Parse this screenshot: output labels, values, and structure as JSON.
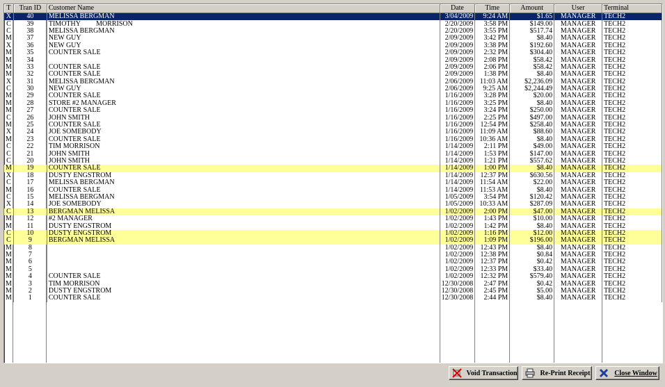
{
  "columns": {
    "type": "T",
    "tran_id": "Tran ID",
    "customer": "Customer Name",
    "date": "Date",
    "time": "Time",
    "amount": "Amount",
    "user": "User",
    "terminal": "Terminal"
  },
  "rows": [
    {
      "type": "X",
      "id": "40",
      "customer": "MELISSA BERGMAN",
      "date": "3/04/2009",
      "time": "9:24 AM",
      "amount": "$1.65",
      "user": "MANAGER",
      "terminal": "TECH2",
      "state": "selected"
    },
    {
      "type": "C",
      "id": "39",
      "customer": "TIMOTHY         MORRISON",
      "date": "2/20/2009",
      "time": "3:58 PM",
      "amount": "$149.00",
      "user": "MANAGER",
      "terminal": "TECH2",
      "state": ""
    },
    {
      "type": "C",
      "id": "38",
      "customer": "MELISSA BERGMAN",
      "date": "2/20/2009",
      "time": "3:55 PM",
      "amount": "$517.74",
      "user": "MANAGER",
      "terminal": "TECH2",
      "state": ""
    },
    {
      "type": "M",
      "id": "37",
      "customer": "NEW GUY",
      "date": "2/09/2009",
      "time": "3:42 PM",
      "amount": "$8.40",
      "user": "MANAGER",
      "terminal": "TECH2",
      "state": ""
    },
    {
      "type": "X",
      "id": "36",
      "customer": "NEW GUY",
      "date": "2/09/2009",
      "time": "3:38 PM",
      "amount": "$192.60",
      "user": "MANAGER",
      "terminal": "TECH2",
      "state": ""
    },
    {
      "type": "M",
      "id": "35",
      "customer": "COUNTER SALE",
      "date": "2/09/2009",
      "time": "2:32 PM",
      "amount": "$304.40",
      "user": "MANAGER",
      "terminal": "TECH2",
      "state": ""
    },
    {
      "type": "M",
      "id": "34",
      "customer": "",
      "date": "2/09/2009",
      "time": "2:08 PM",
      "amount": "$58.42",
      "user": "MANAGER",
      "terminal": "TECH2",
      "state": ""
    },
    {
      "type": "M",
      "id": "33",
      "customer": "COUNTER SALE",
      "date": "2/09/2009",
      "time": "2:06 PM",
      "amount": "$58.42",
      "user": "MANAGER",
      "terminal": "TECH2",
      "state": ""
    },
    {
      "type": "M",
      "id": "32",
      "customer": "COUNTER SALE",
      "date": "2/09/2009",
      "time": "1:38 PM",
      "amount": "$8.40",
      "user": "MANAGER",
      "terminal": "TECH2",
      "state": ""
    },
    {
      "type": "X",
      "id": "31",
      "customer": "MELISSA BERGMAN",
      "date": "2/06/2009",
      "time": "11:03 AM",
      "amount": "$2,236.09",
      "user": "MANAGER",
      "terminal": "TECH2",
      "state": ""
    },
    {
      "type": "C",
      "id": "30",
      "customer": "NEW GUY",
      "date": "2/06/2009",
      "time": "9:25 AM",
      "amount": "$2,244.49",
      "user": "MANAGER",
      "terminal": "TECH2",
      "state": ""
    },
    {
      "type": "M",
      "id": "29",
      "customer": "COUNTER SALE",
      "date": "1/16/2009",
      "time": "3:28 PM",
      "amount": "$20.00",
      "user": "MANAGER",
      "terminal": "TECH2",
      "state": ""
    },
    {
      "type": "M",
      "id": "28",
      "customer": "STORE #2 MANAGER",
      "date": "1/16/2009",
      "time": "3:25 PM",
      "amount": "$8.40",
      "user": "MANAGER",
      "terminal": "TECH2",
      "state": ""
    },
    {
      "type": "M",
      "id": "27",
      "customer": "COUNTER SALE",
      "date": "1/16/2009",
      "time": "3:24 PM",
      "amount": "$250.00",
      "user": "MANAGER",
      "terminal": "TECH2",
      "state": ""
    },
    {
      "type": "C",
      "id": "26",
      "customer": "JOHN SMITH",
      "date": "1/16/2009",
      "time": "2:25 PM",
      "amount": "$497.00",
      "user": "MANAGER",
      "terminal": "TECH2",
      "state": ""
    },
    {
      "type": "M",
      "id": "25",
      "customer": "COUNTER SALE",
      "date": "1/16/2009",
      "time": "12:54 PM",
      "amount": "$258.40",
      "user": "MANAGER",
      "terminal": "TECH2",
      "state": ""
    },
    {
      "type": "X",
      "id": "24",
      "customer": "JOE SOMEBODY",
      "date": "1/16/2009",
      "time": "11:09 AM",
      "amount": "$88.60",
      "user": "MANAGER",
      "terminal": "TECH2",
      "state": ""
    },
    {
      "type": "M",
      "id": "23",
      "customer": "COUNTER SALE",
      "date": "1/16/2009",
      "time": "10:36 AM",
      "amount": "$8.40",
      "user": "MANAGER",
      "terminal": "TECH2",
      "state": ""
    },
    {
      "type": "C",
      "id": "22",
      "customer": "TIM MORRISON",
      "date": "1/14/2009",
      "time": "2:11 PM",
      "amount": "$49.00",
      "user": "MANAGER",
      "terminal": "TECH2",
      "state": ""
    },
    {
      "type": "C",
      "id": "21",
      "customer": "JOHN SMITH",
      "date": "1/14/2009",
      "time": "1:53 PM",
      "amount": "$147.00",
      "user": "MANAGER",
      "terminal": "TECH2",
      "state": ""
    },
    {
      "type": "C",
      "id": "20",
      "customer": "JOHN SMITH",
      "date": "1/14/2009",
      "time": "1:21 PM",
      "amount": "$557.62",
      "user": "MANAGER",
      "terminal": "TECH2",
      "state": ""
    },
    {
      "type": "M",
      "id": "19",
      "customer": "COUNTER SALE",
      "date": "1/14/2009",
      "time": "1:00 PM",
      "amount": "$8.40",
      "user": "MANAGER",
      "terminal": "TECH2",
      "state": "highlight"
    },
    {
      "type": "X",
      "id": "18",
      "customer": "DUSTY ENGSTROM",
      "date": "1/14/2009",
      "time": "12:37 PM",
      "amount": "$630.56",
      "user": "MANAGER",
      "terminal": "TECH2",
      "state": ""
    },
    {
      "type": "C",
      "id": "17",
      "customer": "MELISSA BERGMAN",
      "date": "1/14/2009",
      "time": "11:54 AM",
      "amount": "$22.00",
      "user": "MANAGER",
      "terminal": "TECH2",
      "state": ""
    },
    {
      "type": "M",
      "id": "16",
      "customer": "COUNTER SALE",
      "date": "1/14/2009",
      "time": "11:53 AM",
      "amount": "$8.40",
      "user": "MANAGER",
      "terminal": "TECH2",
      "state": ""
    },
    {
      "type": "C",
      "id": "15",
      "customer": "MELISSA BERGMAN",
      "date": "1/05/2009",
      "time": "3:54 PM",
      "amount": "$120.42",
      "user": "MANAGER",
      "terminal": "TECH2",
      "state": ""
    },
    {
      "type": "X",
      "id": "14",
      "customer": "JOE SOMEBODY",
      "date": "1/05/2009",
      "time": "10:33 AM",
      "amount": "$287.09",
      "user": "MANAGER",
      "terminal": "TECH2",
      "state": ""
    },
    {
      "type": "C",
      "id": "13",
      "customer": "BERGMAN MELISSA",
      "date": "1/02/2009",
      "time": "2:00 PM",
      "amount": "$47.00",
      "user": "MANAGER",
      "terminal": "TECH2",
      "state": "highlight"
    },
    {
      "type": "M",
      "id": "12",
      "customer": "#2 MANAGER",
      "date": "1/02/2009",
      "time": "1:43 PM",
      "amount": "$10.00",
      "user": "MANAGER",
      "terminal": "TECH2",
      "state": ""
    },
    {
      "type": "M",
      "id": "11",
      "customer": "DUSTY ENGSTROM",
      "date": "1/02/2009",
      "time": "1:42 PM",
      "amount": "$8.40",
      "user": "MANAGER",
      "terminal": "TECH2",
      "state": ""
    },
    {
      "type": "C",
      "id": "10",
      "customer": "DUSTY ENGSTROM",
      "date": "1/02/2009",
      "time": "1:16 PM",
      "amount": "$12.00",
      "user": "MANAGER",
      "terminal": "TECH2",
      "state": "highlight"
    },
    {
      "type": "C",
      "id": "9",
      "customer": "BERGMAN MELISSA",
      "date": "1/02/2009",
      "time": "1:09 PM",
      "amount": "$196.00",
      "user": "MANAGER",
      "terminal": "TECH2",
      "state": "highlight"
    },
    {
      "type": "M",
      "id": "8",
      "customer": "",
      "date": "1/02/2009",
      "time": "12:43 PM",
      "amount": "$8.40",
      "user": "MANAGER",
      "terminal": "TECH2",
      "state": ""
    },
    {
      "type": "M",
      "id": "7",
      "customer": "",
      "date": "1/02/2009",
      "time": "12:38 PM",
      "amount": "$0.84",
      "user": "MANAGER",
      "terminal": "TECH2",
      "state": ""
    },
    {
      "type": "M",
      "id": "6",
      "customer": "",
      "date": "1/02/2009",
      "time": "12:37 PM",
      "amount": "$0.42",
      "user": "MANAGER",
      "terminal": "TECH2",
      "state": ""
    },
    {
      "type": "M",
      "id": "5",
      "customer": "",
      "date": "1/02/2009",
      "time": "12:33 PM",
      "amount": "$33.40",
      "user": "MANAGER",
      "terminal": "TECH2",
      "state": ""
    },
    {
      "type": "M",
      "id": "4",
      "customer": "COUNTER SALE",
      "date": "1/02/2009",
      "time": "12:32 PM",
      "amount": "$579.40",
      "user": "MANAGER",
      "terminal": "TECH2",
      "state": ""
    },
    {
      "type": "M",
      "id": "3",
      "customer": "TIM MORRISON",
      "date": "12/30/2008",
      "time": "2:47 PM",
      "amount": "$0.42",
      "user": "MANAGER",
      "terminal": "TECH2",
      "state": ""
    },
    {
      "type": "M",
      "id": "2",
      "customer": "DUSTY ENGSTROM",
      "date": "12/30/2008",
      "time": "2:45 PM",
      "amount": "$5.00",
      "user": "MANAGER",
      "terminal": "TECH2",
      "state": ""
    },
    {
      "type": "M",
      "id": "1",
      "customer": "COUNTER SALE",
      "date": "12/30/2008",
      "time": "2:44 PM",
      "amount": "$8.40",
      "user": "MANAGER",
      "terminal": "TECH2",
      "state": ""
    }
  ],
  "buttons": {
    "void": {
      "label": "Void Transaction",
      "icon": "void-icon"
    },
    "reprint": {
      "label": "Re-Print Receipt",
      "icon": "printer-icon"
    },
    "close": {
      "label": "Close Window",
      "icon": "close-x-icon"
    }
  },
  "colors": {
    "selected_bg": "#0a246a",
    "highlight_bg": "#ffff99",
    "window_bg": "#d4d0c8"
  }
}
